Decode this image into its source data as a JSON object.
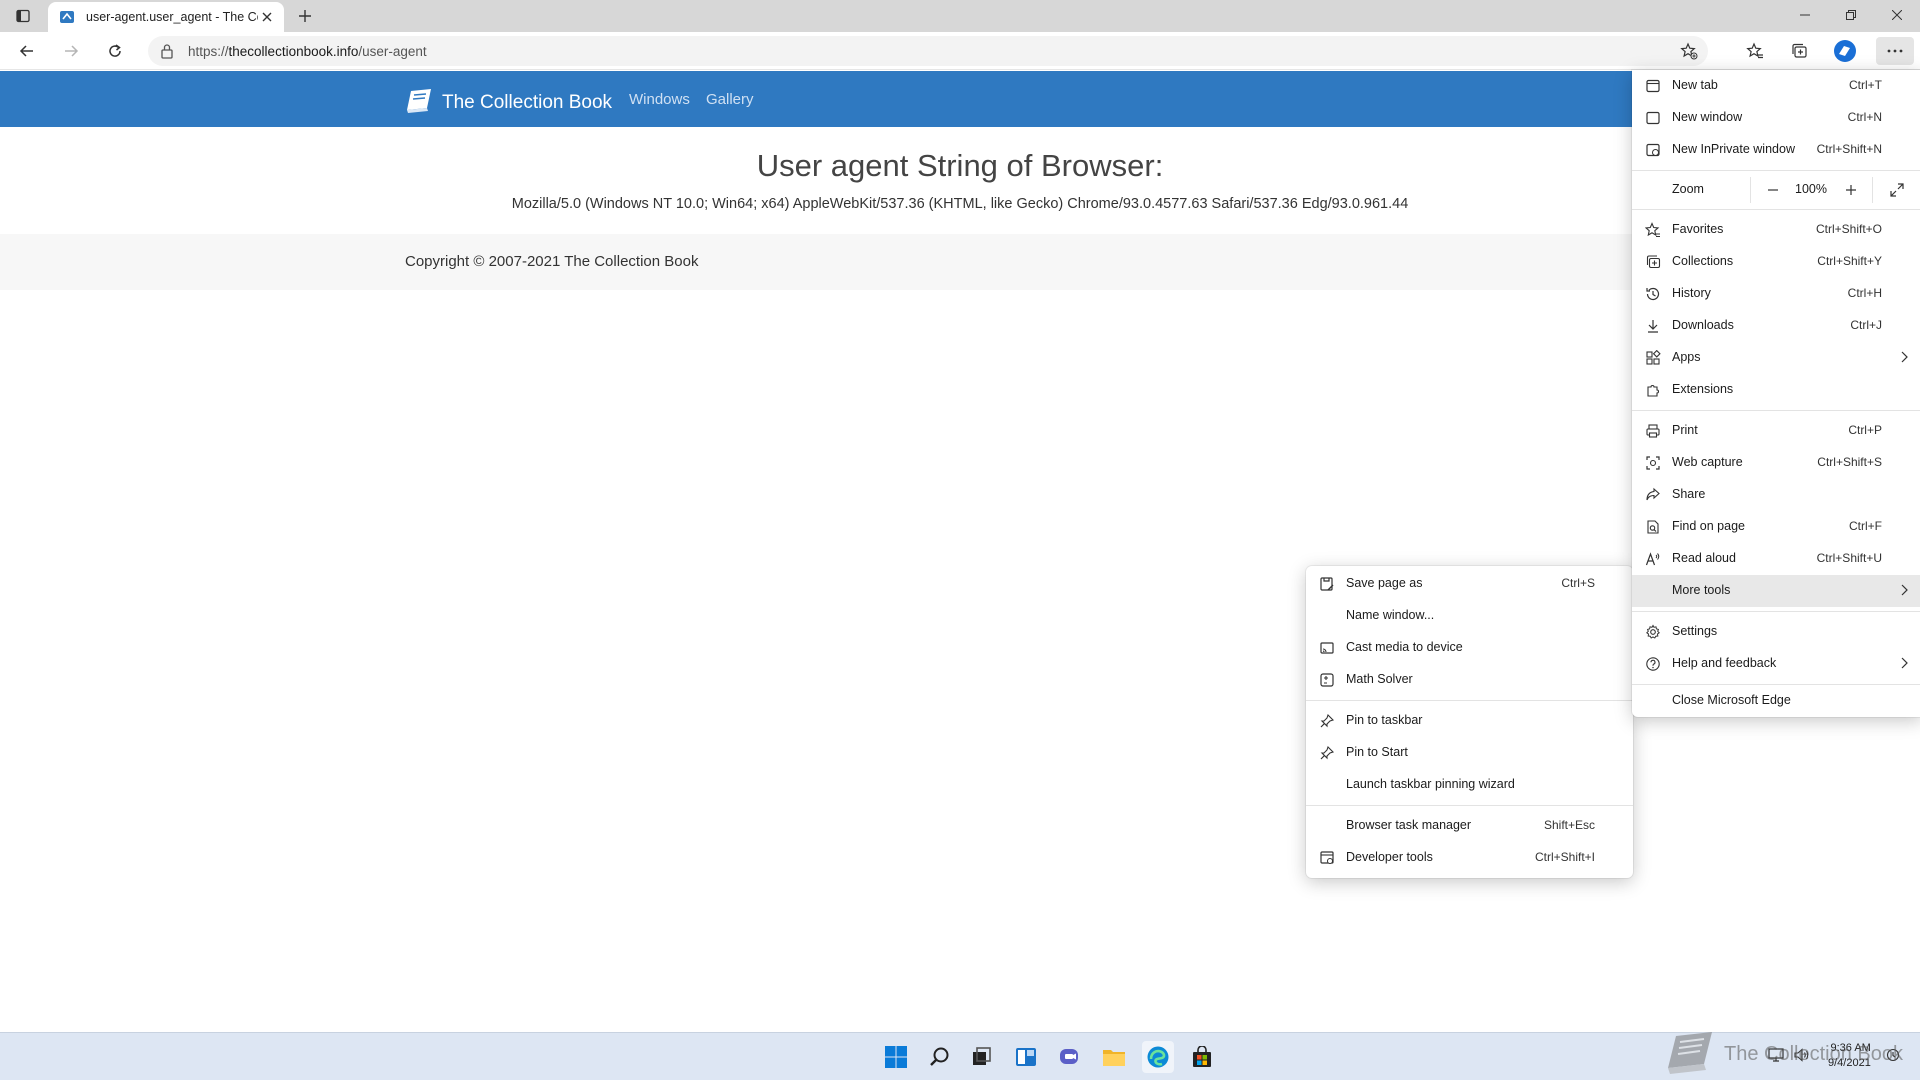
{
  "browser": {
    "tab_title": "user-agent.user_agent - The Coll",
    "url_prefix": "https://",
    "url_host": "thecollectionbook.info",
    "url_path": "/user-agent"
  },
  "site": {
    "brand": "The Collection Book",
    "nav": [
      "Windows",
      "Gallery"
    ],
    "heading": "User agent String of Browser:",
    "ua": "Mozilla/5.0 (Windows NT 10.0; Win64; x64) AppleWebKit/537.36 (KHTML, like Gecko) Chrome/93.0.4577.63 Safari/537.36 Edg/93.0.961.44",
    "copyright": "Copyright © 2007-2021 The Collection Book"
  },
  "menu": {
    "new_tab": {
      "label": "New tab",
      "shortcut": "Ctrl+T"
    },
    "new_window": {
      "label": "New window",
      "shortcut": "Ctrl+N"
    },
    "new_inprivate": {
      "label": "New InPrivate window",
      "shortcut": "Ctrl+Shift+N"
    },
    "zoom": {
      "label": "Zoom",
      "value": "100%"
    },
    "favorites": {
      "label": "Favorites",
      "shortcut": "Ctrl+Shift+O"
    },
    "collections": {
      "label": "Collections",
      "shortcut": "Ctrl+Shift+Y"
    },
    "history": {
      "label": "History",
      "shortcut": "Ctrl+H"
    },
    "downloads": {
      "label": "Downloads",
      "shortcut": "Ctrl+J"
    },
    "apps": {
      "label": "Apps"
    },
    "extensions": {
      "label": "Extensions"
    },
    "print": {
      "label": "Print",
      "shortcut": "Ctrl+P"
    },
    "web_capture": {
      "label": "Web capture",
      "shortcut": "Ctrl+Shift+S"
    },
    "share": {
      "label": "Share"
    },
    "find": {
      "label": "Find on page",
      "shortcut": "Ctrl+F"
    },
    "read_aloud": {
      "label": "Read aloud",
      "shortcut": "Ctrl+Shift+U"
    },
    "more_tools": {
      "label": "More tools"
    },
    "settings": {
      "label": "Settings"
    },
    "help": {
      "label": "Help and feedback"
    },
    "close_edge": {
      "label": "Close Microsoft Edge"
    }
  },
  "submenu": {
    "save_page": {
      "label": "Save page as",
      "shortcut": "Ctrl+S"
    },
    "name_window": {
      "label": "Name window..."
    },
    "cast": {
      "label": "Cast media to device"
    },
    "math": {
      "label": "Math Solver"
    },
    "pin_taskbar": {
      "label": "Pin to taskbar"
    },
    "pin_start": {
      "label": "Pin to Start"
    },
    "pin_wizard": {
      "label": "Launch taskbar pinning wizard"
    },
    "task_manager": {
      "label": "Browser task manager",
      "shortcut": "Shift+Esc"
    },
    "dev_tools": {
      "label": "Developer tools",
      "shortcut": "Ctrl+Shift+I"
    }
  },
  "taskbar": {
    "time": "9:36 AM",
    "date": "9/4/2021",
    "watermark": "The Collection Book"
  },
  "colors": {
    "nav_blue": "#2f79c1",
    "menu_highlight": "#e8e8e8",
    "edge_blue": "#1a6fd6"
  }
}
